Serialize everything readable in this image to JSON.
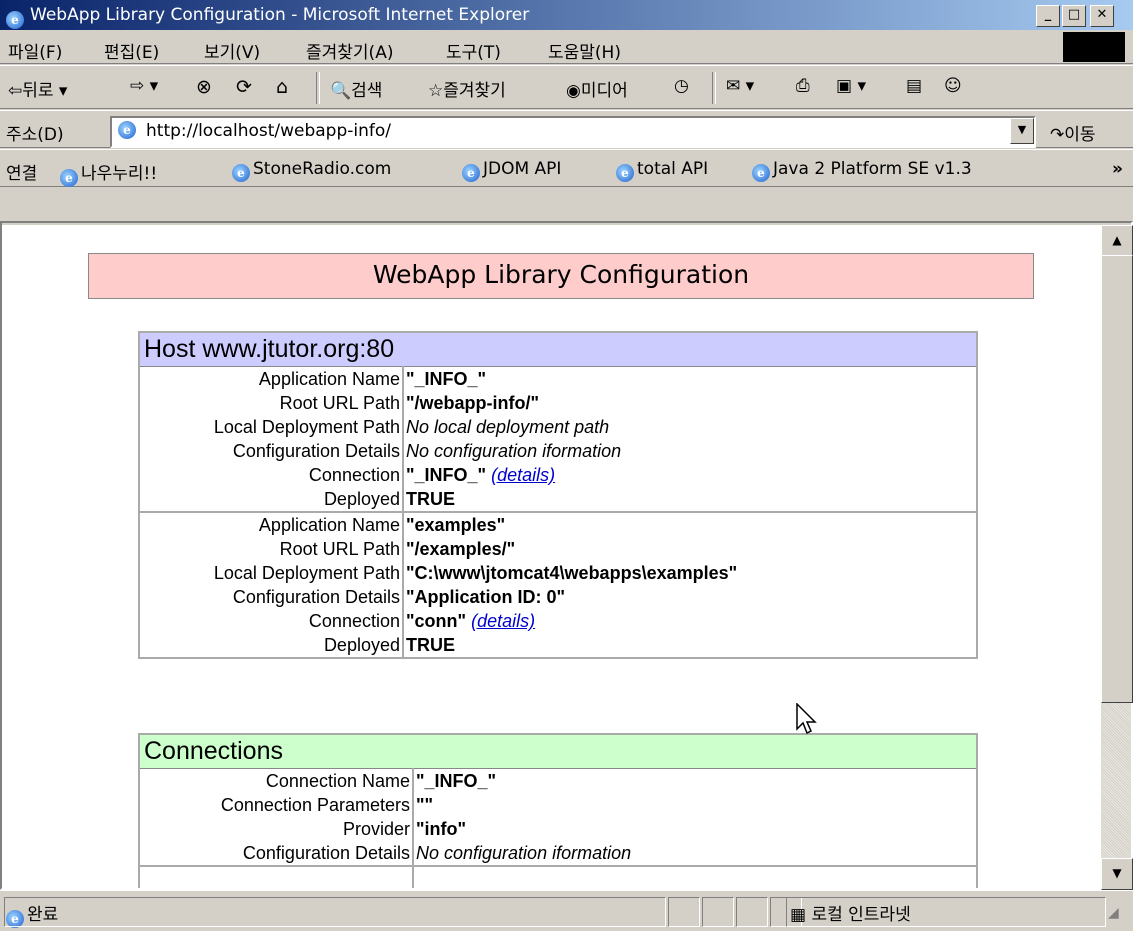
{
  "window": {
    "title": "WebApp Library Configuration - Microsoft Internet Explorer"
  },
  "menu": [
    "파일(F)",
    "편집(E)",
    "보기(V)",
    "즐겨찾기(A)",
    "도구(T)",
    "도움말(H)"
  ],
  "toolbar": {
    "back": "뒤로",
    "search": "검색",
    "favorites": "즐겨찾기",
    "media": "미디어"
  },
  "address": {
    "label": "주소(D)",
    "url": "http://localhost/webapp-info/",
    "go": "이동"
  },
  "links": {
    "label": "연결",
    "items": [
      "나우누리!!",
      "StoneRadio.com",
      "JDOM API",
      "total API",
      "Java 2 Platform SE v1.3"
    ]
  },
  "page": {
    "title": "WebApp Library Configuration",
    "host": {
      "heading": "Host www.jtutor.org:80",
      "labels": [
        "Application Name",
        "Root URL Path",
        "Local Deployment Path",
        "Configuration Details",
        "Connection",
        "Deployed"
      ],
      "apps": [
        {
          "name": "\"_INFO_\"",
          "root": "\"/webapp-info/\"",
          "local": "No local deployment path",
          "config": "No configuration iformation",
          "connection": "\"_INFO_\"",
          "details": "(details)",
          "deployed": "TRUE"
        },
        {
          "name": "\"examples\"",
          "root": "\"/examples/\"",
          "local": "\"C:\\www\\jtomcat4\\webapps\\examples\"",
          "config": "\"Application ID: 0\"",
          "connection": "\"conn\"",
          "details": "(details)",
          "deployed": "TRUE"
        }
      ]
    },
    "connections": {
      "heading": "Connections",
      "labels": [
        "Connection Name",
        "Connection Parameters",
        "Provider",
        "Configuration Details"
      ],
      "items": [
        {
          "name": "\"_INFO_\"",
          "params": "\"\"",
          "provider": "\"info\"",
          "config": "No configuration iformation"
        }
      ]
    }
  },
  "status": {
    "text": "완료",
    "zone": "로컬 인트라넷"
  },
  "colors": {
    "title_bg": "#ffcccc",
    "host_bg": "#ccccff",
    "conn_bg": "#ccffcc",
    "link": "#0000cc"
  }
}
